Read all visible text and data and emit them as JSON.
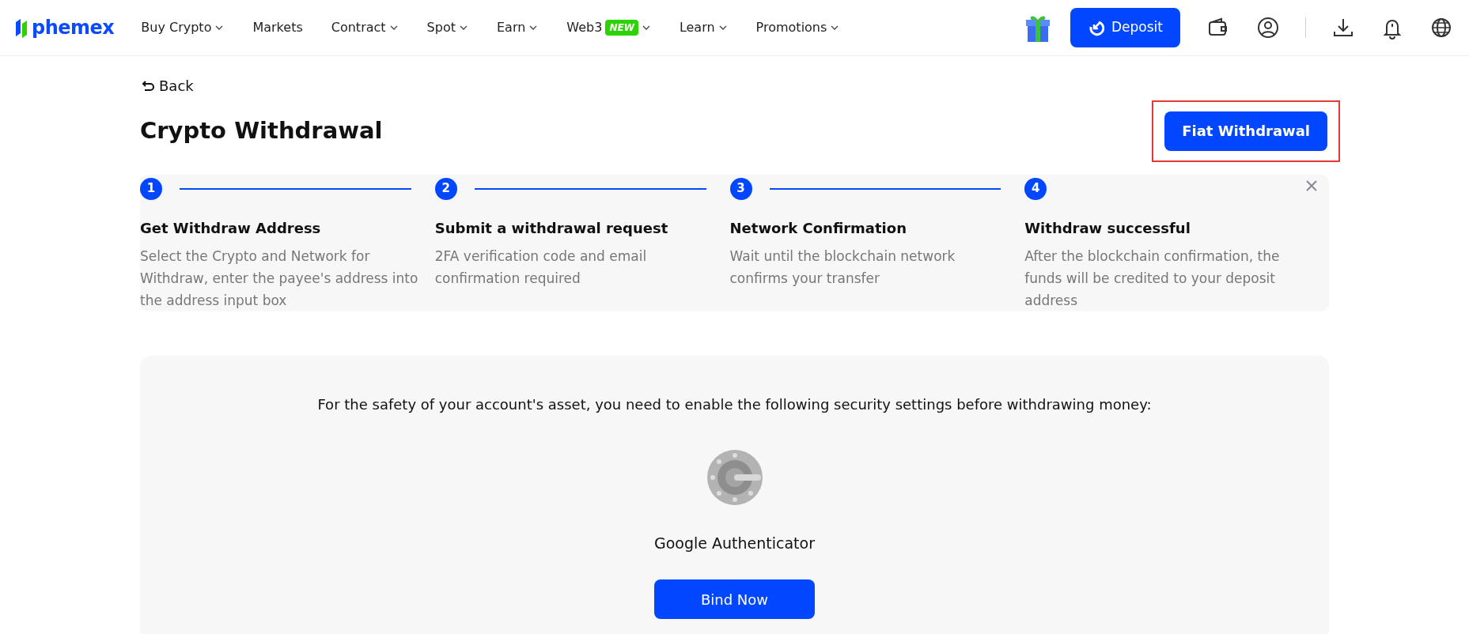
{
  "navbar": {
    "brand": "phemex",
    "items": [
      {
        "label": "Buy Crypto",
        "dropdown": true
      },
      {
        "label": "Markets",
        "dropdown": false
      },
      {
        "label": "Contract",
        "dropdown": true
      },
      {
        "label": "Spot",
        "dropdown": true
      },
      {
        "label": "Earn",
        "dropdown": true
      },
      {
        "label": "Web3",
        "badge": "NEW",
        "dropdown": true
      },
      {
        "label": "Learn",
        "dropdown": true
      },
      {
        "label": "Promotions",
        "dropdown": true
      }
    ],
    "deposit_button": "Deposit"
  },
  "back_link": "Back",
  "title": "Crypto Withdrawal",
  "fiat_button": {
    "label": "Fiat Withdrawal",
    "highlighted": true
  },
  "steps": [
    {
      "number": "1",
      "title": "Get Withdraw Address",
      "description": "Select the Crypto and Network for Withdraw, enter the payee's address into the address input box"
    },
    {
      "number": "2",
      "title": "Submit a withdrawal request",
      "description": "2FA verification code and email confirmation required"
    },
    {
      "number": "3",
      "title": "Network Confirmation",
      "description": "Wait until the blockchain network confirms your transfer"
    },
    {
      "number": "4",
      "title": "Withdraw successful",
      "description": "After the blockchain confirmation, the funds will be credited to your deposit address"
    }
  ],
  "security": {
    "message": "For the safety of your account's asset, you need to enable the following security settings before withdrawing money:",
    "method": "Google Authenticator",
    "button": "Bind Now"
  }
}
